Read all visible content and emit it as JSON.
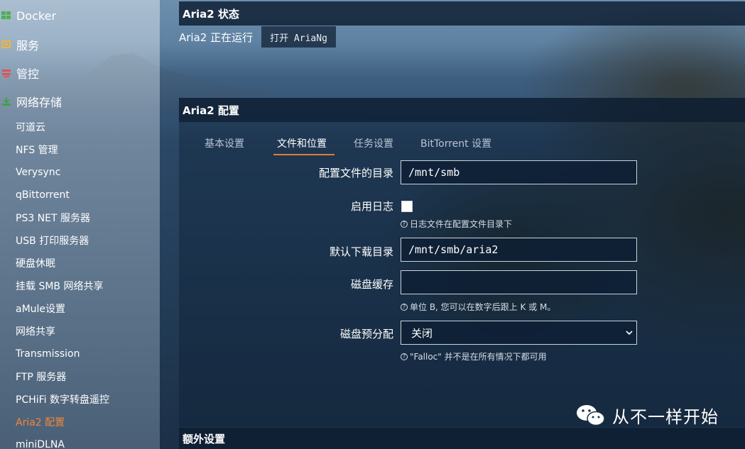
{
  "sidebar": {
    "groups": [
      {
        "label": "Docker",
        "icon": "docker-icon",
        "color": "#4caf50"
      },
      {
        "label": "服务",
        "icon": "services-icon",
        "color": "#f2b632"
      },
      {
        "label": "管控",
        "icon": "control-icon",
        "color": "#e05353"
      },
      {
        "label": "网络存储",
        "icon": "nas-icon",
        "color": "#43a047"
      }
    ],
    "items": [
      {
        "label": "可道云"
      },
      {
        "label": "NFS 管理"
      },
      {
        "label": "Verysync"
      },
      {
        "label": "qBittorrent"
      },
      {
        "label": "PS3 NET 服务器"
      },
      {
        "label": "USB 打印服务器"
      },
      {
        "label": "硬盘休眠"
      },
      {
        "label": "挂载 SMB 网络共享"
      },
      {
        "label": "aMule设置"
      },
      {
        "label": "网络共享"
      },
      {
        "label": "Transmission"
      },
      {
        "label": "FTP 服务器"
      },
      {
        "label": "PCHiFi 数字转盘遥控"
      },
      {
        "label": "Aria2 配置",
        "active": true
      },
      {
        "label": "miniDLNA"
      }
    ]
  },
  "status_section": {
    "title": "Aria2 状态",
    "status_text": "Aria2 正在运行",
    "open_button": "打开 AriaNg"
  },
  "config_section": {
    "title": "Aria2 配置",
    "tabs": [
      {
        "label": "基本设置"
      },
      {
        "label": "文件和位置",
        "active": true
      },
      {
        "label": "任务设置"
      },
      {
        "label": "BitTorrent 设置"
      }
    ],
    "fields": {
      "config_dir": {
        "label": "配置文件的目录",
        "value": "/mnt/smb"
      },
      "enable_log": {
        "label": "启用日志",
        "checked": false,
        "hint": "日志文件在配置文件目录下"
      },
      "download_dir": {
        "label": "默认下载目录",
        "value": "/mnt/smb/aria2"
      },
      "disk_cache": {
        "label": "磁盘缓存",
        "value": "",
        "hint": "单位 B, 您可以在数字后跟上 K 或 M。"
      },
      "file_allocation": {
        "label": "磁盘预分配",
        "value": "关闭",
        "hint": "\"Falloc\" 并不是在所有情况下都可用"
      }
    }
  },
  "extra_section": {
    "title": "额外设置"
  },
  "watermark": {
    "text": "从不一样开始"
  },
  "colors": {
    "accent": "#e8793a",
    "active_sidebar": "#f0883a"
  }
}
